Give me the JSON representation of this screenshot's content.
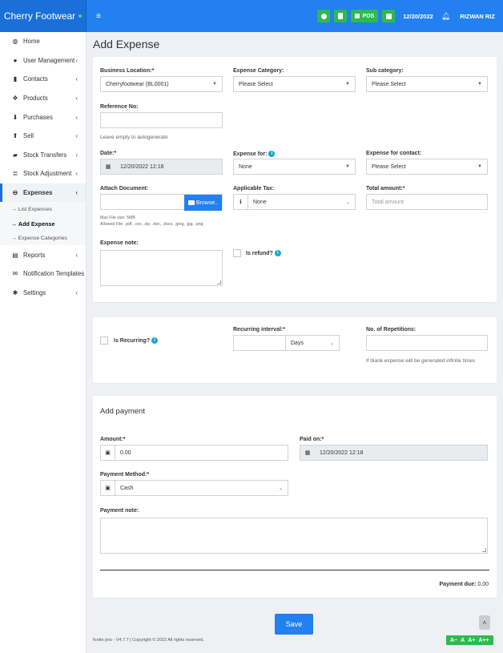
{
  "brand": {
    "name": "Cherry Footwear"
  },
  "header": {
    "pos_label": "POS",
    "date": "12/20/2022",
    "user": "RIZWAN RIZ"
  },
  "sidebar": {
    "items": [
      {
        "label": "Home",
        "icon": "dashboard-icon"
      },
      {
        "label": "User Management",
        "icon": "users-icon"
      },
      {
        "label": "Contacts",
        "icon": "address-book-icon"
      },
      {
        "label": "Products",
        "icon": "cubes-icon"
      },
      {
        "label": "Purchases",
        "icon": "arrow-circle-down-icon"
      },
      {
        "label": "Sell",
        "icon": "arrow-circle-up-icon"
      },
      {
        "label": "Stock Transfers",
        "icon": "truck-icon"
      },
      {
        "label": "Stock Adjustment",
        "icon": "database-icon"
      },
      {
        "label": "Expenses",
        "icon": "minus-circle-icon"
      },
      {
        "label": "Reports",
        "icon": "chart-icon"
      },
      {
        "label": "Notification Templates",
        "icon": "envelope-icon"
      },
      {
        "label": "Settings",
        "icon": "cog-icon"
      }
    ],
    "expenses_sub": [
      "→ List Expenses",
      "→ Add Expense",
      "→ Expense Categories"
    ]
  },
  "page": {
    "title": "Add Expense"
  },
  "form": {
    "business_location": {
      "label": "Business Location:*",
      "value": "Cherryfootwear (BL0001)"
    },
    "expense_category": {
      "label": "Expense Category:",
      "value": "Please Select"
    },
    "sub_category": {
      "label": "Sub category:",
      "value": "Please Select"
    },
    "reference_no": {
      "label": "Reference No:",
      "help": "Leave empty to autogenerate"
    },
    "date": {
      "label": "Date:*",
      "value": "12/20/2022 12:18"
    },
    "expense_for": {
      "label": "Expense for:",
      "value": "None"
    },
    "expense_for_contact": {
      "label": "Expense for contact:",
      "value": "Please Select"
    },
    "attach_document": {
      "label": "Attach Document:",
      "browse": "Browse..",
      "help1": "Max File size: 5MB",
      "help2": "Allowed File: .pdf, .csv, .zip, .doc, .docx, .jpeg, .jpg, .png"
    },
    "applicable_tax": {
      "label": "Applicable Tax:",
      "value": "None"
    },
    "total_amount": {
      "label": "Total amount:*",
      "placeholder": "Total amount"
    },
    "expense_note": {
      "label": "Expense note:"
    },
    "is_refund": {
      "label": "Is refund?"
    }
  },
  "recurring": {
    "is_recurring": "Is Recurring?",
    "interval_label": "Recurring interval:*",
    "interval_unit": "Days",
    "repetitions_label": "No. of Repetitions:",
    "repetitions_help": "If blank expense will be generated infinite times"
  },
  "payment": {
    "title": "Add payment",
    "amount_label": "Amount:*",
    "amount_value": "0.00",
    "paid_on_label": "Paid on:*",
    "paid_on_value": "12/20/2022 12:18",
    "method_label": "Payment Method:*",
    "method_value": "Cash",
    "note_label": "Payment note:",
    "due_label": "Payment due:",
    "due_value": "0.00"
  },
  "actions": {
    "save": "Save"
  },
  "footer": {
    "text": "footie pos - V4.7.7 | Copyright © 2022 All rights reserved."
  },
  "font_controls": [
    "A−",
    "A",
    "A+",
    "A++"
  ],
  "colors": {
    "primary": "#2280f0",
    "brand": "#1b6fd8",
    "success": "#2dbb4e",
    "info": "#1aa6c9"
  }
}
